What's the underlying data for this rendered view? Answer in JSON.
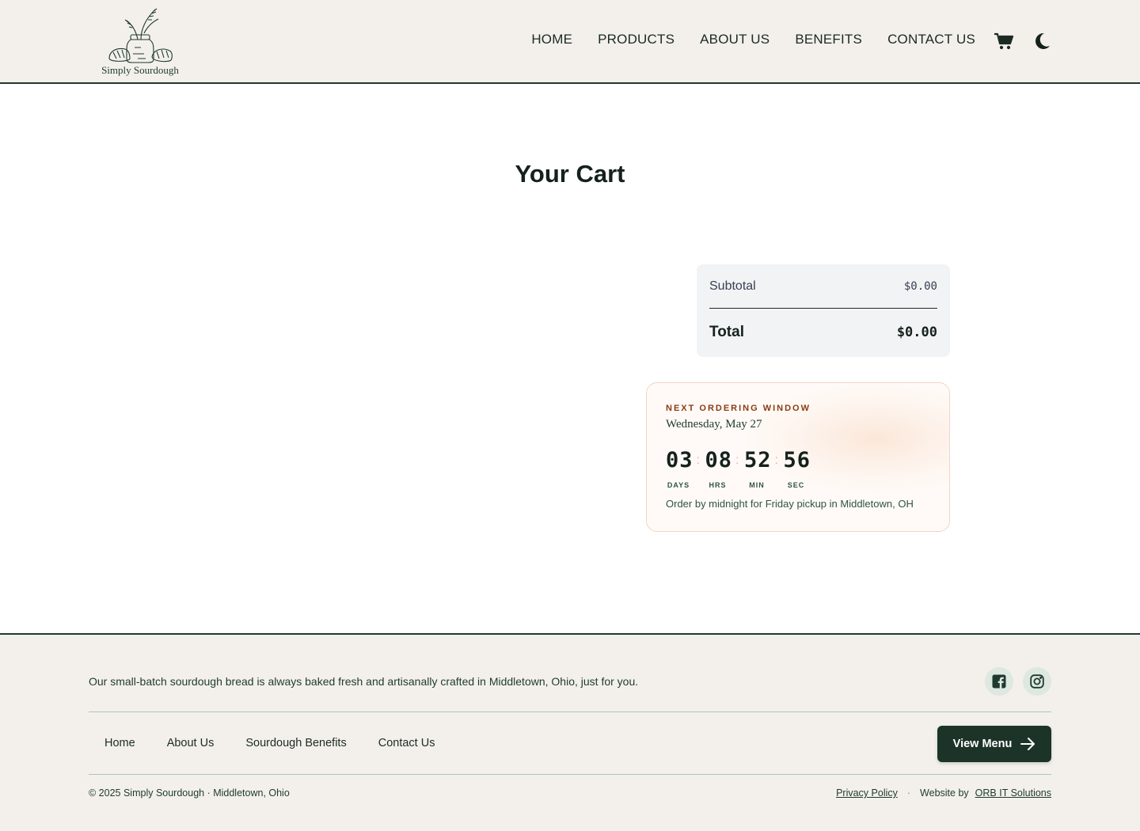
{
  "brand": {
    "name": "Simply Sourdough",
    "logo_icon": "bread-jar-logo"
  },
  "nav": {
    "items": [
      "HOME",
      "PRODUCTS",
      "ABOUT US",
      "BENEFITS",
      "CONTACT US"
    ],
    "cart_icon": "cart-icon",
    "theme_icon": "moon-icon"
  },
  "main": {
    "title": "Your Cart",
    "summary": {
      "subtotal_label": "Subtotal",
      "subtotal_value": "$0.00",
      "total_label": "Total",
      "total_value": "$0.00"
    },
    "ordering_window": {
      "eyebrow": "NEXT ORDERING WINDOW",
      "date": "Wednesday, May 27",
      "countdown": [
        {
          "value": "03",
          "label": "DAYS"
        },
        {
          "value": "08",
          "label": "HRS"
        },
        {
          "value": "52",
          "label": "MIN"
        },
        {
          "value": "56",
          "label": "SEC"
        }
      ],
      "separator": ":",
      "note": "Order by midnight for Friday pickup in Middletown, OH"
    }
  },
  "footer": {
    "tagline": "Our small-batch sourdough bread is always baked fresh and artisanally crafted in Middletown, Ohio, just for you.",
    "social_icons": [
      "facebook-icon",
      "instagram-icon"
    ],
    "links": [
      "Home",
      "About Us",
      "Sourdough Benefits",
      "Contact Us"
    ],
    "cta_label": "View Menu",
    "copyright": "© 2025 Simply Sourdough · Middletown, Ohio",
    "privacy_label": "Privacy Policy",
    "separator": "·",
    "credit_prefix": "Website by",
    "credit_link": "ORB IT Solutions"
  },
  "colors": {
    "header_bg": "#f3f0eb",
    "brand_green": "#1f3a2e",
    "cta_bg": "#1c3328",
    "accent_rust": "#8a3b12",
    "summary_bg": "#f2f3f5"
  }
}
